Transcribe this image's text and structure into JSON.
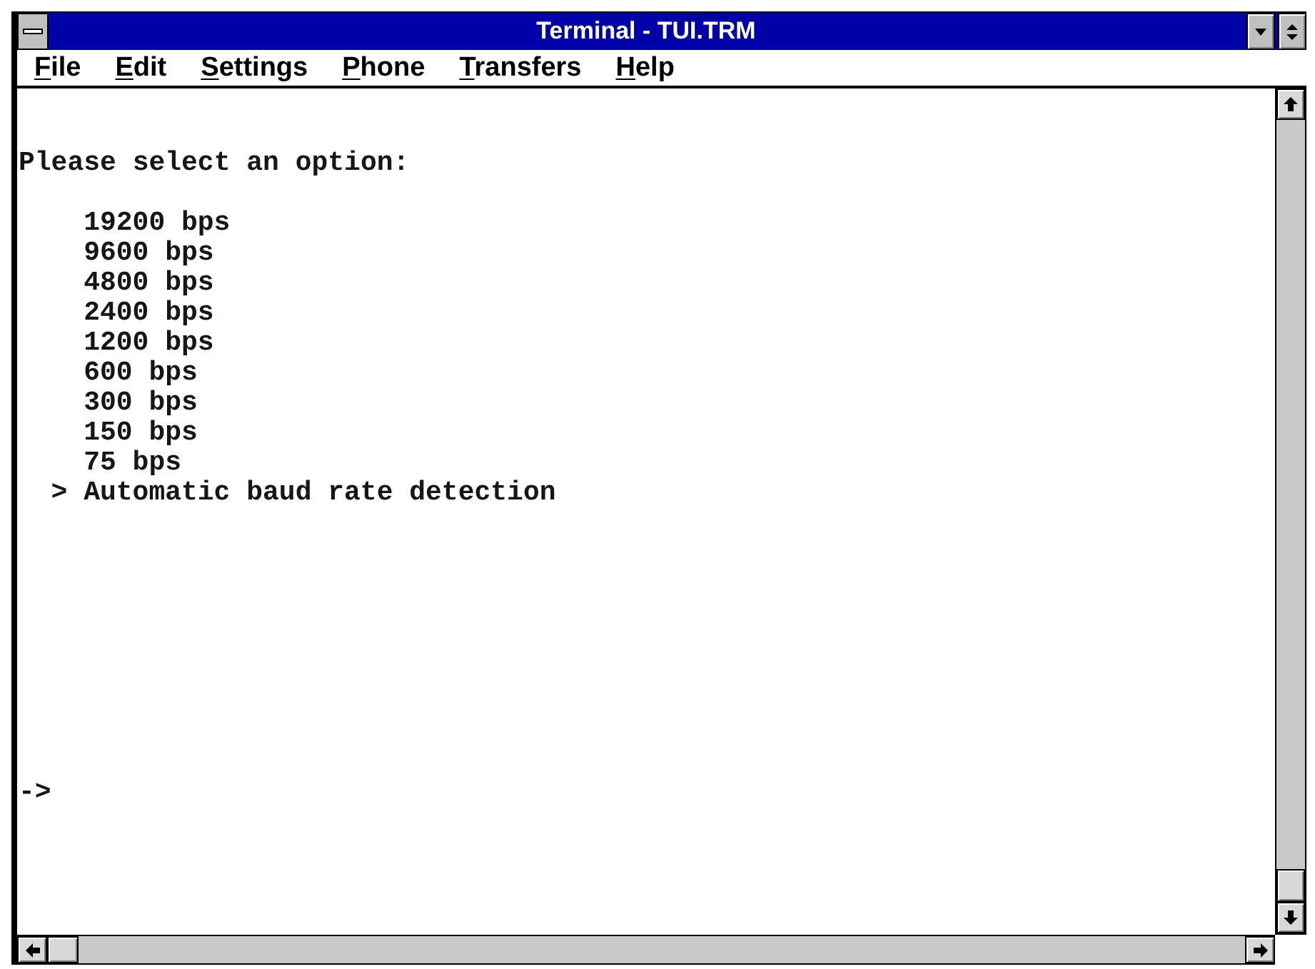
{
  "window": {
    "title": "Terminal - TUI.TRM"
  },
  "menu_bar": [
    "File",
    "Edit",
    "Settings",
    "Phone",
    "Transfers",
    "Help"
  ],
  "terminal": {
    "heading": "Please select an option:",
    "selection_marker": ">",
    "options": [
      {
        "label": "19200 bps",
        "selected": false
      },
      {
        "label": "9600 bps",
        "selected": false
      },
      {
        "label": "4800 bps",
        "selected": false
      },
      {
        "label": "2400 bps",
        "selected": false
      },
      {
        "label": "1200 bps",
        "selected": false
      },
      {
        "label": "600 bps",
        "selected": false
      },
      {
        "label": "300 bps",
        "selected": false
      },
      {
        "label": "150 bps",
        "selected": false
      },
      {
        "label": "75 bps",
        "selected": false
      },
      {
        "label": "Automatic baud rate detection",
        "selected": true
      }
    ],
    "command_prompt": "->"
  }
}
